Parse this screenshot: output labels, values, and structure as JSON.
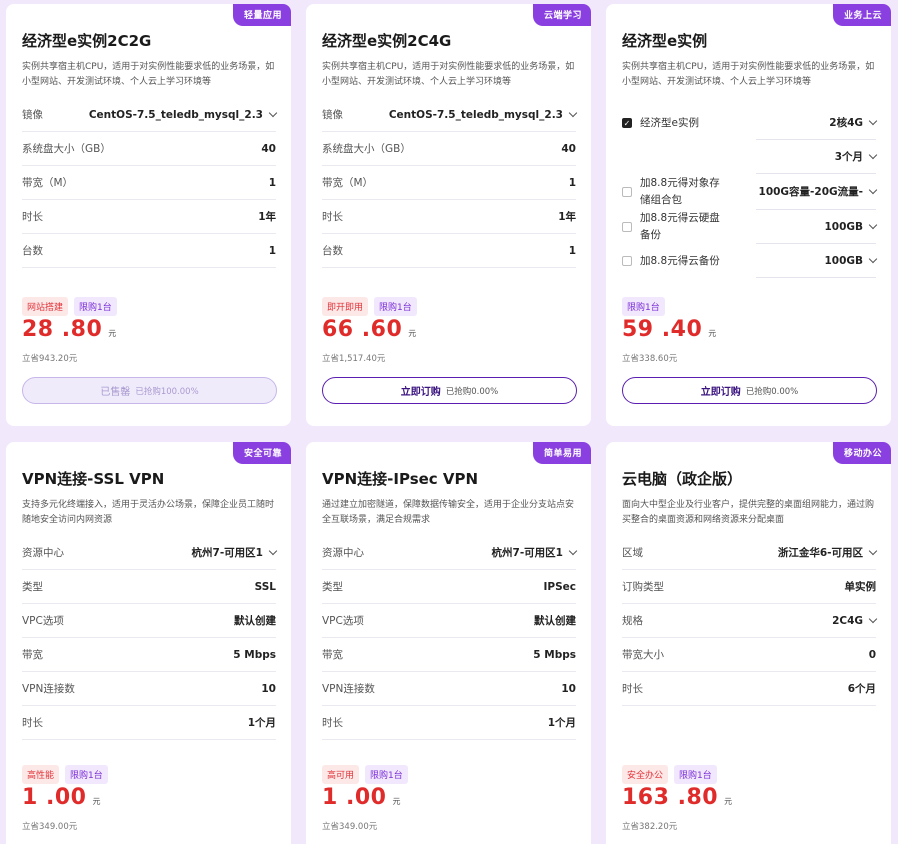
{
  "cards": [
    {
      "tag": "轻量应用",
      "title": "经济型e实例2C2G",
      "desc": "实例共享宿主机CPU，适用于对实例性能要求低的业务场景，如小型网站、开发测试环境、个人云上学习环境等",
      "rows": [
        {
          "label": "镜像",
          "value": "CentOS-7.5_teledb_mysql_2.3"
        },
        {
          "label": "系统盘大小（GB）",
          "value": "40"
        },
        {
          "label": "带宽（M）",
          "value": "1"
        },
        {
          "label": "时长",
          "value": "1年"
        },
        {
          "label": "台数",
          "value": "1"
        }
      ],
      "badges": [
        "网站搭建",
        "限购1台"
      ],
      "price": "28 .80",
      "unit": "元",
      "save": "立省943.20元",
      "button": "已售罄",
      "button_sub": "已抢购100.00%"
    },
    {
      "tag": "云端学习",
      "title": "经济型e实例2C4G",
      "desc": "实例共享宿主机CPU，适用于对实例性能要求低的业务场景，如小型网站、开发测试环境、个人云上学习环境等",
      "rows": [
        {
          "label": "镜像",
          "value": "CentOS-7.5_teledb_mysql_2.3"
        },
        {
          "label": "系统盘大小（GB）",
          "value": "40"
        },
        {
          "label": "带宽（M）",
          "value": "1"
        },
        {
          "label": "时长",
          "value": "1年"
        },
        {
          "label": "台数",
          "value": "1"
        }
      ],
      "badges": [
        "即开即用",
        "限购1台"
      ],
      "price": "66 .60",
      "unit": "元",
      "save": "立省1,517.40元",
      "button": "立即订购",
      "button_sub": "已抢购0.00%"
    },
    {
      "tag": "业务上云",
      "title": "经济型e实例",
      "desc": "实例共享宿主机CPU，适用于对实例性能要求低的业务场景，如小型网站、开发测试环境、个人云上学习环境等",
      "options": [
        {
          "label": "经济型e实例",
          "value": "2核4G",
          "checked": true
        },
        {
          "label": "",
          "value": "3个月"
        },
        {
          "label": "加8.8元得对象存储组合包",
          "value": "100G容量-20G流量-"
        },
        {
          "label": "加8.8元得云硬盘备份",
          "value": "100GB"
        },
        {
          "label": "加8.8元得云备份",
          "value": "100GB"
        }
      ],
      "badges": [
        "限购1台"
      ],
      "price": "59 .40",
      "unit": "元",
      "save": "立省338.60元",
      "button": "立即订购",
      "button_sub": "已抢购0.00%"
    },
    {
      "tag": "安全可靠",
      "title": "VPN连接-SSL VPN",
      "desc": "支持多元化终端接入，适用于灵活办公场景，保障企业员工随时随地安全访问内网资源",
      "rows": [
        {
          "label": "资源中心",
          "value": "杭州7-可用区1"
        },
        {
          "label": "类型",
          "value": "SSL"
        },
        {
          "label": "VPC选项",
          "value": "默认创建"
        },
        {
          "label": "带宽",
          "value": "5 Mbps"
        },
        {
          "label": "VPN连接数",
          "value": "10"
        },
        {
          "label": "时长",
          "value": "1个月"
        }
      ],
      "badges": [
        "高性能",
        "限购1台"
      ],
      "price": "1 .00",
      "unit": "元",
      "save": "立省349.00元"
    },
    {
      "tag": "简单易用",
      "title": "VPN连接-IPsec VPN",
      "desc": "通过建立加密隧道，保障数据传输安全，适用于企业分支站点安全互联场景，满足合规需求",
      "rows": [
        {
          "label": "资源中心",
          "value": "杭州7-可用区1"
        },
        {
          "label": "类型",
          "value": "IPSec"
        },
        {
          "label": "VPC选项",
          "value": "默认创建"
        },
        {
          "label": "带宽",
          "value": "5 Mbps"
        },
        {
          "label": "VPN连接数",
          "value": "10"
        },
        {
          "label": "时长",
          "value": "1个月"
        }
      ],
      "badges": [
        "高可用",
        "限购1台"
      ],
      "price": "1 .00",
      "unit": "元",
      "save": "立省349.00元"
    },
    {
      "tag": "移动办公",
      "title": "云电脑（政企版）",
      "desc": "面向大中型企业及行业客户，提供完整的桌面组网能力，通过购买整合的桌面资源和网络资源来分配桌面",
      "rows": [
        {
          "label": "区域",
          "value": "浙江金华6-可用区"
        },
        {
          "label": "订购类型",
          "value": "单实例"
        },
        {
          "label": "规格",
          "value": "2C4G"
        },
        {
          "label": "带宽大小",
          "value": "0"
        },
        {
          "label": "时长",
          "value": "6个月"
        }
      ],
      "badges": [
        "安全办公",
        "限购1台"
      ],
      "price": "163 .80",
      "unit": "元",
      "save": "立省382.20元"
    }
  ]
}
